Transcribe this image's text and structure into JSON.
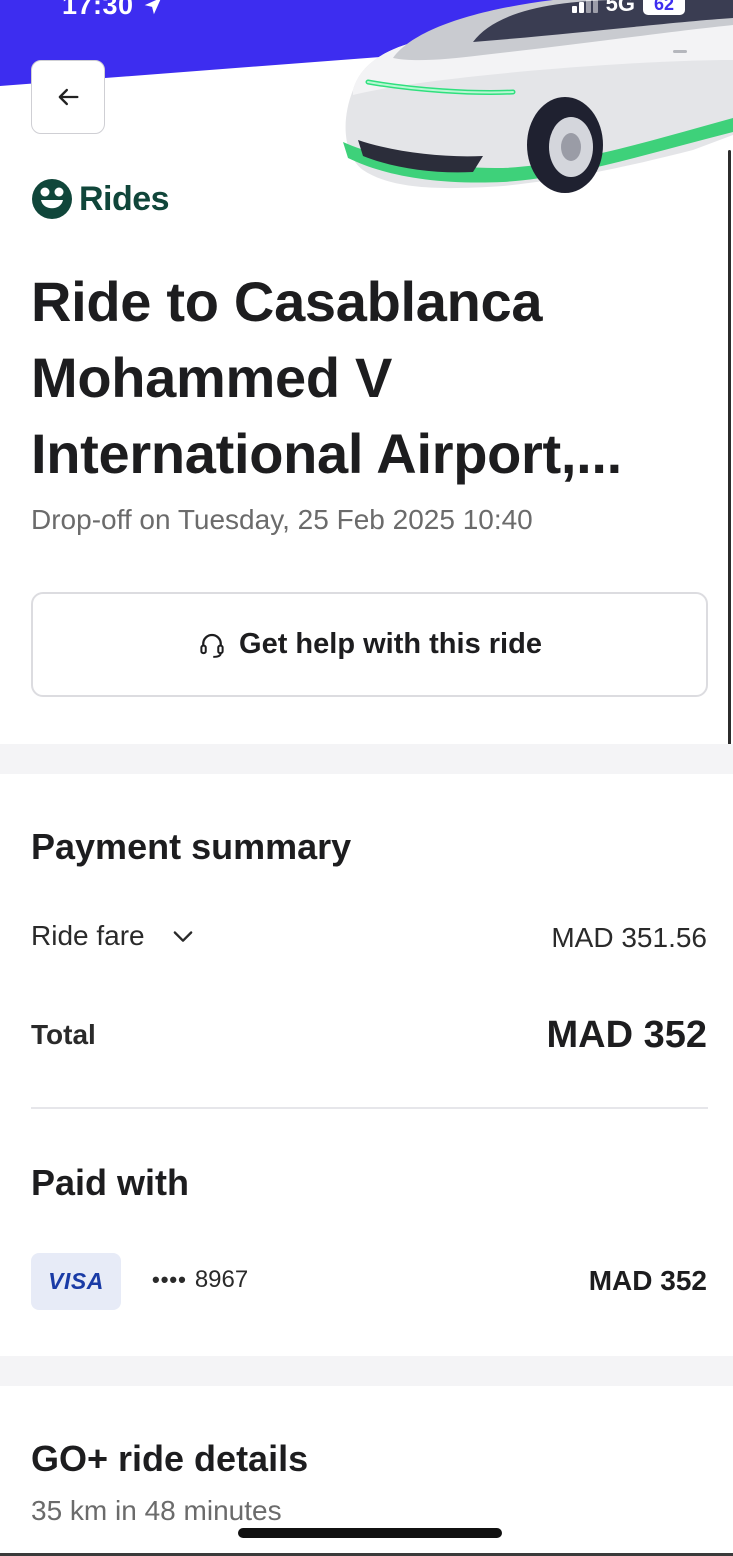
{
  "status_bar": {
    "time": "17:30",
    "network": "5G",
    "battery": "62"
  },
  "app": {
    "logo_text": "Rides",
    "brand_color": "#10463a",
    "banner_color": "#3d2df0",
    "accent_green": "#3ed17a"
  },
  "ride": {
    "title": "Ride to Casablanca Mohammed V International Airport,...",
    "dropoff": "Drop-off on Tuesday, 25 Feb 2025 10:40"
  },
  "help": {
    "label": "Get help with this ride",
    "icon": "headset-icon"
  },
  "payment": {
    "section_title": "Payment summary",
    "fare_label": "Ride fare",
    "fare_value": "MAD 351.56",
    "total_label": "Total",
    "total_value": "MAD 352"
  },
  "paid_with": {
    "section_title": "Paid with",
    "card_brand": "VISA",
    "card_dots": "••••",
    "card_last4": "8967",
    "amount": "MAD 352"
  },
  "details": {
    "section_title": "GO+ ride details",
    "summary": "35 km in 48 minutes"
  }
}
